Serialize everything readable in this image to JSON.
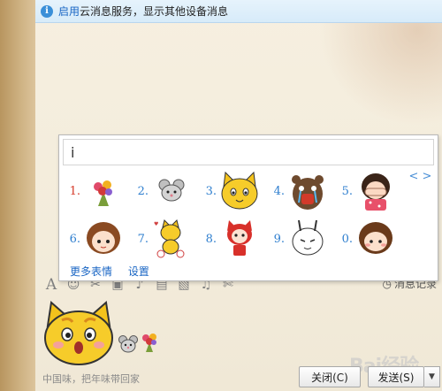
{
  "notice": {
    "link_text": "启用",
    "message": "云消息服务，显示其他设备消息"
  },
  "emoji_popup": {
    "search_value": "i",
    "prev_label": "<",
    "next_label": ">",
    "candidates": [
      {
        "num": "1.",
        "icon": "flower-bouquet-sticker"
      },
      {
        "num": "2.",
        "icon": "mouse-sticker"
      },
      {
        "num": "3.",
        "icon": "yellow-cat-sticker"
      },
      {
        "num": "4.",
        "icon": "crying-bear-sticker"
      },
      {
        "num": "5.",
        "icon": "girl-covering-face-sticker"
      },
      {
        "num": "6.",
        "icon": "brown-hair-girl-sticker"
      },
      {
        "num": "7.",
        "icon": "cat-shopping-sticker"
      },
      {
        "num": "8.",
        "icon": "red-fox-girl-sticker"
      },
      {
        "num": "9.",
        "icon": "tuzki-rabbit-sticker"
      },
      {
        "num": "0.",
        "icon": "mocmoc-girl-sticker"
      }
    ],
    "more_label": "更多表情",
    "settings_label": "设置"
  },
  "toolbar": {
    "history_label": "消息记录"
  },
  "input": {
    "signature": "中国味，把年味带回家"
  },
  "buttons": {
    "close_label": "关闭(C)",
    "send_label": "发送(S)"
  },
  "watermark": "Bai经验",
  "colors": {
    "accent": "#1a66c4",
    "notice_bg": "#d7ebf9",
    "number_red": "#d63a2a",
    "number_blue": "#2f7fcf"
  }
}
